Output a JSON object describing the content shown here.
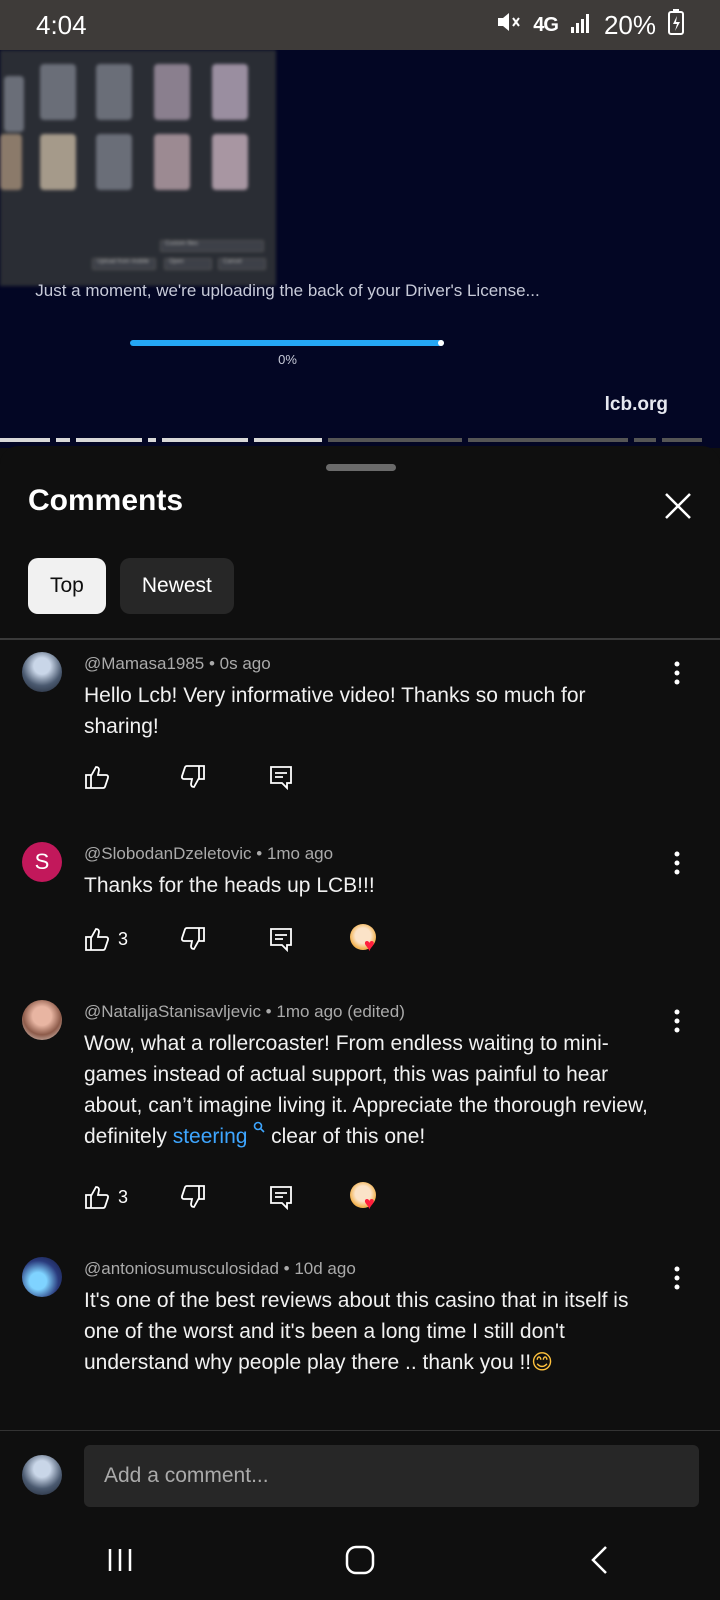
{
  "status_bar": {
    "time": "4:04",
    "network": "4G",
    "battery": "20%"
  },
  "video": {
    "overlay_buttons": [
      "Upload from mobile",
      "Open",
      "Cancel"
    ],
    "overlay_filter": "Custom files",
    "upload_message": "Just a moment, we're uploading the back of your Driver's License...",
    "upload_progress_label": "0%",
    "upload_progress": 0,
    "watermark": "lcb.org"
  },
  "sheet": {
    "title": "Comments",
    "tabs": [
      {
        "label": "Top",
        "active": true
      },
      {
        "label": "Newest",
        "active": false
      }
    ]
  },
  "comments": [
    {
      "author": "@Mamasa1985",
      "time": "0s ago",
      "text": "Hello Lcb! Very informative video! Thanks so much for sharing!",
      "likes": "",
      "creator_heart": false
    },
    {
      "author": "@SlobodanDzeletovic",
      "time": "1mo ago",
      "avatar_letter": "S",
      "text": "Thanks for the heads up LCB!!!",
      "likes": "3",
      "creator_heart": true
    },
    {
      "author": "@NatalijaStanisavljevic",
      "time": "1mo ago (edited)",
      "text_before": "Wow, what a rollercoaster! From endless waiting to mini-games instead of actual support, this was painful to hear about, can’t imagine living it. Appreciate the thorough review, definitely ",
      "link": "steering",
      "text_after": " clear of this one!",
      "likes": "3",
      "creator_heart": true
    },
    {
      "author": "@antoniosumusculosidad",
      "time": "10d ago",
      "text": "It's one of the best reviews about this casino that in itself is one of the worst and it's been a long time I still don't understand why people play there .. thank you !!",
      "emoji": "😊"
    }
  ],
  "input": {
    "placeholder": "Add a comment..."
  },
  "colors": {
    "accent_link": "#3ea6ff",
    "heart": "#ff1f3d",
    "progress": "#25a7f5"
  }
}
